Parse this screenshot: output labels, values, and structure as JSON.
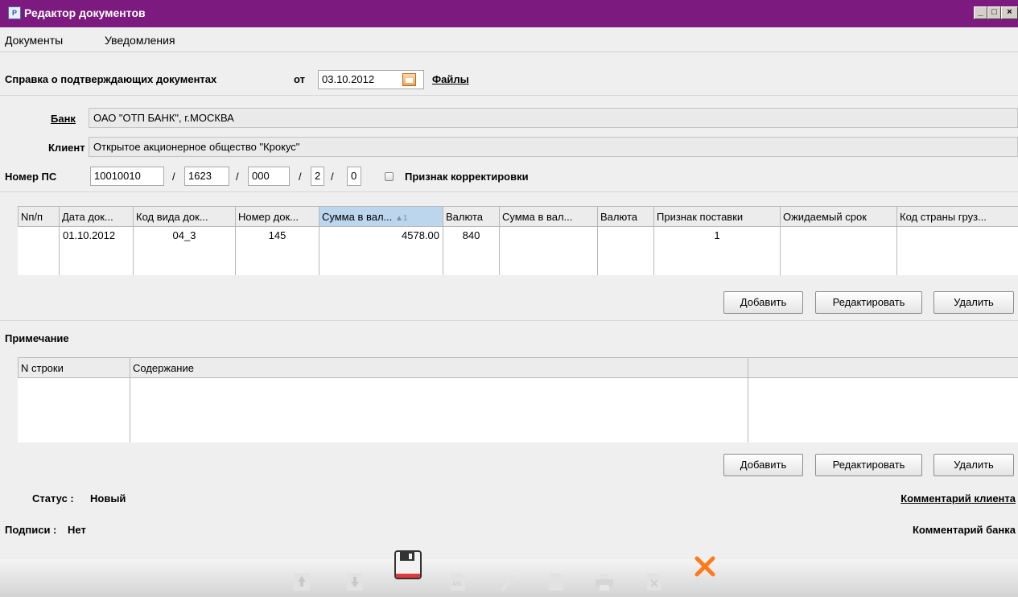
{
  "window": {
    "title": "Редактор документов"
  },
  "menu": {
    "items": [
      "Документы",
      "Уведомления"
    ]
  },
  "header": {
    "doc_title": "Справка о подтверждающих документах",
    "date_label": "от",
    "date_value": "03.10.2012",
    "files_link": "Файлы"
  },
  "bank": {
    "label": "Банк",
    "value": "ОАО \"ОТП БАНК\", г.МОСКВА"
  },
  "client": {
    "label": "Клиент",
    "value": "Открытое акционерное общество \"Крокус\""
  },
  "ps": {
    "label": "Номер ПС",
    "parts": [
      "10010010",
      "1623",
      "000",
      "2",
      "0"
    ],
    "separator": "/",
    "correction_label": "Признак корректировки",
    "correction_checked": false
  },
  "docs_table": {
    "columns": [
      "Nп/п",
      "Дата док...",
      "Код вида док...",
      "Номер док...",
      "Сумма в вал...",
      "Валюта",
      "Сумма в вал...",
      "Валюта",
      "Признак поставки",
      "Ожидаемый срок",
      "Код страны груз..."
    ],
    "sort_indicator": "▲1",
    "rows": [
      [
        "",
        "01.10.2012",
        "04_3",
        "145",
        "4578.00",
        "840",
        "",
        "",
        "1",
        "",
        ""
      ]
    ]
  },
  "buttons": {
    "add": "Добавить",
    "edit": "Редактировать",
    "delete": "Удалить"
  },
  "notes": {
    "title": "Примечание",
    "columns": [
      "N строки",
      "Содержание",
      ""
    ]
  },
  "status": {
    "label": "Статус :",
    "value": "Новый"
  },
  "signatures": {
    "label": "Подписи :",
    "value": "Нет"
  },
  "comments": {
    "client": "Комментарий клиента",
    "bank": "Комментарий банка"
  },
  "toolbar_icons": [
    "arrow-up-icon",
    "arrow-down-icon",
    "save-icon",
    "export-icon",
    "edit-icon",
    "document-icon",
    "print-icon",
    "delete-icon",
    "close-icon"
  ],
  "colors": {
    "titlebar": "#7d1a80",
    "accent_close": "#ff7a1a",
    "sorted_header": "#bcd6ee"
  }
}
